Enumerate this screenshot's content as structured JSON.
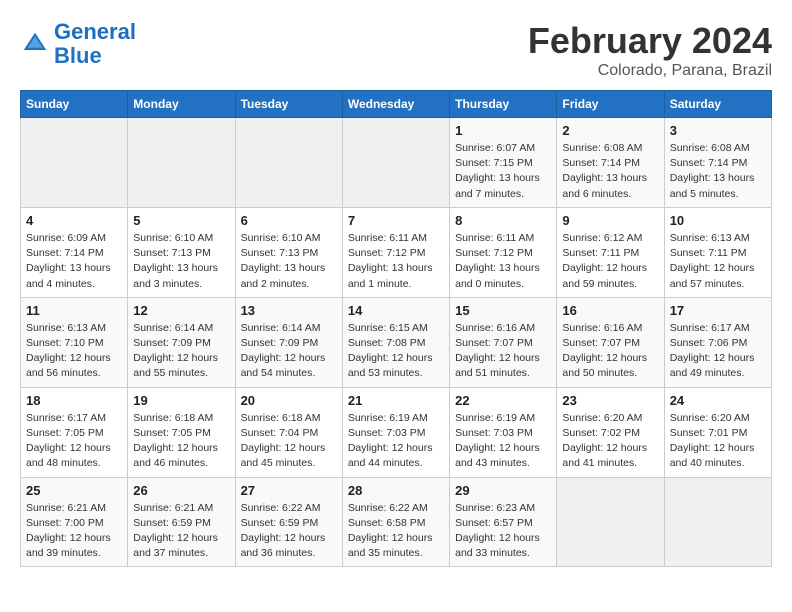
{
  "logo": {
    "line1": "General",
    "line2": "Blue"
  },
  "title": "February 2024",
  "subtitle": "Colorado, Parana, Brazil",
  "headers": [
    "Sunday",
    "Monday",
    "Tuesday",
    "Wednesday",
    "Thursday",
    "Friday",
    "Saturday"
  ],
  "weeks": [
    [
      {
        "day": "",
        "detail": "",
        "empty": true
      },
      {
        "day": "",
        "detail": "",
        "empty": true
      },
      {
        "day": "",
        "detail": "",
        "empty": true
      },
      {
        "day": "",
        "detail": "",
        "empty": true
      },
      {
        "day": "1",
        "detail": "Sunrise: 6:07 AM\nSunset: 7:15 PM\nDaylight: 13 hours\nand 7 minutes."
      },
      {
        "day": "2",
        "detail": "Sunrise: 6:08 AM\nSunset: 7:14 PM\nDaylight: 13 hours\nand 6 minutes."
      },
      {
        "day": "3",
        "detail": "Sunrise: 6:08 AM\nSunset: 7:14 PM\nDaylight: 13 hours\nand 5 minutes."
      }
    ],
    [
      {
        "day": "4",
        "detail": "Sunrise: 6:09 AM\nSunset: 7:14 PM\nDaylight: 13 hours\nand 4 minutes."
      },
      {
        "day": "5",
        "detail": "Sunrise: 6:10 AM\nSunset: 7:13 PM\nDaylight: 13 hours\nand 3 minutes."
      },
      {
        "day": "6",
        "detail": "Sunrise: 6:10 AM\nSunset: 7:13 PM\nDaylight: 13 hours\nand 2 minutes."
      },
      {
        "day": "7",
        "detail": "Sunrise: 6:11 AM\nSunset: 7:12 PM\nDaylight: 13 hours\nand 1 minute."
      },
      {
        "day": "8",
        "detail": "Sunrise: 6:11 AM\nSunset: 7:12 PM\nDaylight: 13 hours\nand 0 minutes."
      },
      {
        "day": "9",
        "detail": "Sunrise: 6:12 AM\nSunset: 7:11 PM\nDaylight: 12 hours\nand 59 minutes."
      },
      {
        "day": "10",
        "detail": "Sunrise: 6:13 AM\nSunset: 7:11 PM\nDaylight: 12 hours\nand 57 minutes."
      }
    ],
    [
      {
        "day": "11",
        "detail": "Sunrise: 6:13 AM\nSunset: 7:10 PM\nDaylight: 12 hours\nand 56 minutes."
      },
      {
        "day": "12",
        "detail": "Sunrise: 6:14 AM\nSunset: 7:09 PM\nDaylight: 12 hours\nand 55 minutes."
      },
      {
        "day": "13",
        "detail": "Sunrise: 6:14 AM\nSunset: 7:09 PM\nDaylight: 12 hours\nand 54 minutes."
      },
      {
        "day": "14",
        "detail": "Sunrise: 6:15 AM\nSunset: 7:08 PM\nDaylight: 12 hours\nand 53 minutes."
      },
      {
        "day": "15",
        "detail": "Sunrise: 6:16 AM\nSunset: 7:07 PM\nDaylight: 12 hours\nand 51 minutes."
      },
      {
        "day": "16",
        "detail": "Sunrise: 6:16 AM\nSunset: 7:07 PM\nDaylight: 12 hours\nand 50 minutes."
      },
      {
        "day": "17",
        "detail": "Sunrise: 6:17 AM\nSunset: 7:06 PM\nDaylight: 12 hours\nand 49 minutes."
      }
    ],
    [
      {
        "day": "18",
        "detail": "Sunrise: 6:17 AM\nSunset: 7:05 PM\nDaylight: 12 hours\nand 48 minutes."
      },
      {
        "day": "19",
        "detail": "Sunrise: 6:18 AM\nSunset: 7:05 PM\nDaylight: 12 hours\nand 46 minutes."
      },
      {
        "day": "20",
        "detail": "Sunrise: 6:18 AM\nSunset: 7:04 PM\nDaylight: 12 hours\nand 45 minutes."
      },
      {
        "day": "21",
        "detail": "Sunrise: 6:19 AM\nSunset: 7:03 PM\nDaylight: 12 hours\nand 44 minutes."
      },
      {
        "day": "22",
        "detail": "Sunrise: 6:19 AM\nSunset: 7:03 PM\nDaylight: 12 hours\nand 43 minutes."
      },
      {
        "day": "23",
        "detail": "Sunrise: 6:20 AM\nSunset: 7:02 PM\nDaylight: 12 hours\nand 41 minutes."
      },
      {
        "day": "24",
        "detail": "Sunrise: 6:20 AM\nSunset: 7:01 PM\nDaylight: 12 hours\nand 40 minutes."
      }
    ],
    [
      {
        "day": "25",
        "detail": "Sunrise: 6:21 AM\nSunset: 7:00 PM\nDaylight: 12 hours\nand 39 minutes."
      },
      {
        "day": "26",
        "detail": "Sunrise: 6:21 AM\nSunset: 6:59 PM\nDaylight: 12 hours\nand 37 minutes."
      },
      {
        "day": "27",
        "detail": "Sunrise: 6:22 AM\nSunset: 6:59 PM\nDaylight: 12 hours\nand 36 minutes."
      },
      {
        "day": "28",
        "detail": "Sunrise: 6:22 AM\nSunset: 6:58 PM\nDaylight: 12 hours\nand 35 minutes."
      },
      {
        "day": "29",
        "detail": "Sunrise: 6:23 AM\nSunset: 6:57 PM\nDaylight: 12 hours\nand 33 minutes."
      },
      {
        "day": "",
        "detail": "",
        "empty": true
      },
      {
        "day": "",
        "detail": "",
        "empty": true
      }
    ]
  ]
}
